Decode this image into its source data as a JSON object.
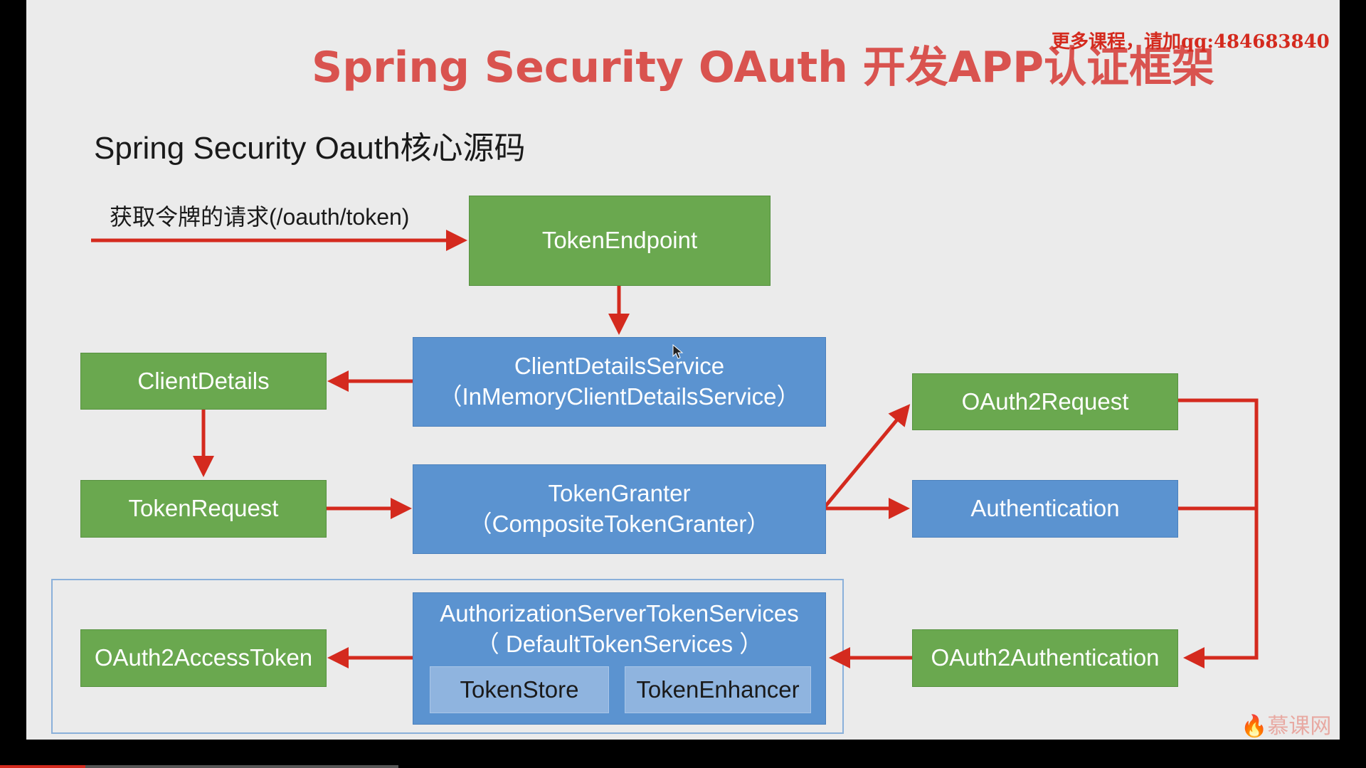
{
  "title": "Spring Security OAuth 开发APP认证框架",
  "watermark": "更多课程，请加qq:484683840",
  "subtitle": "Spring Security Oauth核心源码",
  "request_label": "获取令牌的请求(/oauth/token)",
  "nodes": {
    "token_endpoint": "TokenEndpoint",
    "client_details_service": {
      "line1": "ClientDetailsService",
      "line2": "（InMemoryClientDetailsService）"
    },
    "client_details": "ClientDetails",
    "token_request": "TokenRequest",
    "token_granter": {
      "line1": "TokenGranter",
      "line2": "（CompositeTokenGranter）"
    },
    "oauth2_request": "OAuth2Request",
    "authentication": "Authentication",
    "auth_server_token_services": {
      "line1": "AuthorizationServerTokenServices",
      "line2": "（ DefaultTokenServices ）"
    },
    "token_store": "TokenStore",
    "token_enhancer": "TokenEnhancer",
    "oauth2_access_token": "OAuth2AccessToken",
    "oauth2_authentication": "OAuth2Authentication"
  },
  "logo": "慕课网",
  "colors": {
    "green": "#6aa84f",
    "blue": "#5b93d0",
    "arrow": "#d42a1e",
    "title": "#d9534f"
  }
}
